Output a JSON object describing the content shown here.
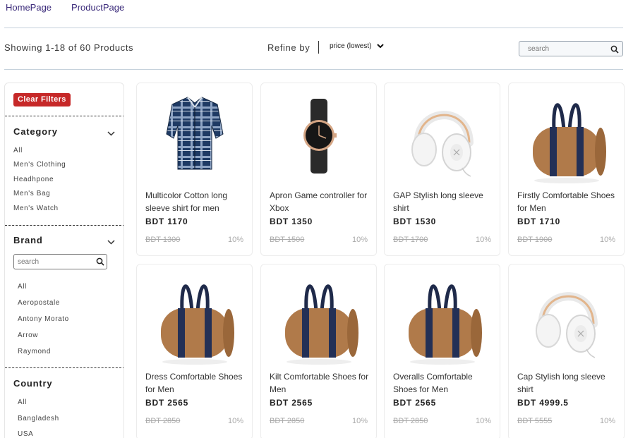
{
  "nav": {
    "home": "HomePage",
    "product": "ProductPage"
  },
  "toolbar": {
    "showing": "Showing 1-18 of 60 Products",
    "refine_label": "Refine by",
    "sort_value": "price (lowest)",
    "search_placeholder": "search"
  },
  "sidebar": {
    "clear_label": "Clear Filters",
    "category": {
      "title": "Category",
      "items": [
        "All",
        "Men's Clothing",
        "Headhpone",
        "Men's Bag",
        "Men's Watch"
      ]
    },
    "brand": {
      "title": "Brand",
      "search_placeholder": "search",
      "items": [
        "All",
        "Aeropostale",
        "Antony Morato",
        "Arrow",
        "Raymond"
      ]
    },
    "country": {
      "title": "Country",
      "items": [
        "All",
        "Bangladesh",
        "USA"
      ]
    }
  },
  "products": [
    {
      "name": "Multicolor Cotton long sleeve shirt for men",
      "price": "BDT 1170",
      "old_price": "BDT 1300",
      "discount": "10%",
      "image": "shirt"
    },
    {
      "name": "Apron Game controller for Xbox",
      "price": "BDT 1350",
      "old_price": "BDT 1500",
      "discount": "10%",
      "image": "watch"
    },
    {
      "name": "GAP Stylish long sleeve shirt",
      "price": "BDT 1530",
      "old_price": "BDT 1700",
      "discount": "10%",
      "image": "headphone"
    },
    {
      "name": "Firstly Comfortable Shoes for Men",
      "price": "BDT 1710",
      "old_price": "BDT 1900",
      "discount": "10%",
      "image": "bag"
    },
    {
      "name": "Dress Comfortable Shoes for Men",
      "price": "BDT 2565",
      "old_price": "BDT 2850",
      "discount": "10%",
      "image": "bag"
    },
    {
      "name": "Kilt Comfortable Shoes for Men",
      "price": "BDT 2565",
      "old_price": "BDT 2850",
      "discount": "10%",
      "image": "bag"
    },
    {
      "name": "Overalls Comfortable Shoes for Men",
      "price": "BDT 2565",
      "old_price": "BDT 2850",
      "discount": "10%",
      "image": "bag"
    },
    {
      "name": "Cap Stylish long sleeve shirt",
      "price": "BDT 4999.5",
      "old_price": "BDT 5555",
      "discount": "10%",
      "image": "headphone"
    }
  ]
}
